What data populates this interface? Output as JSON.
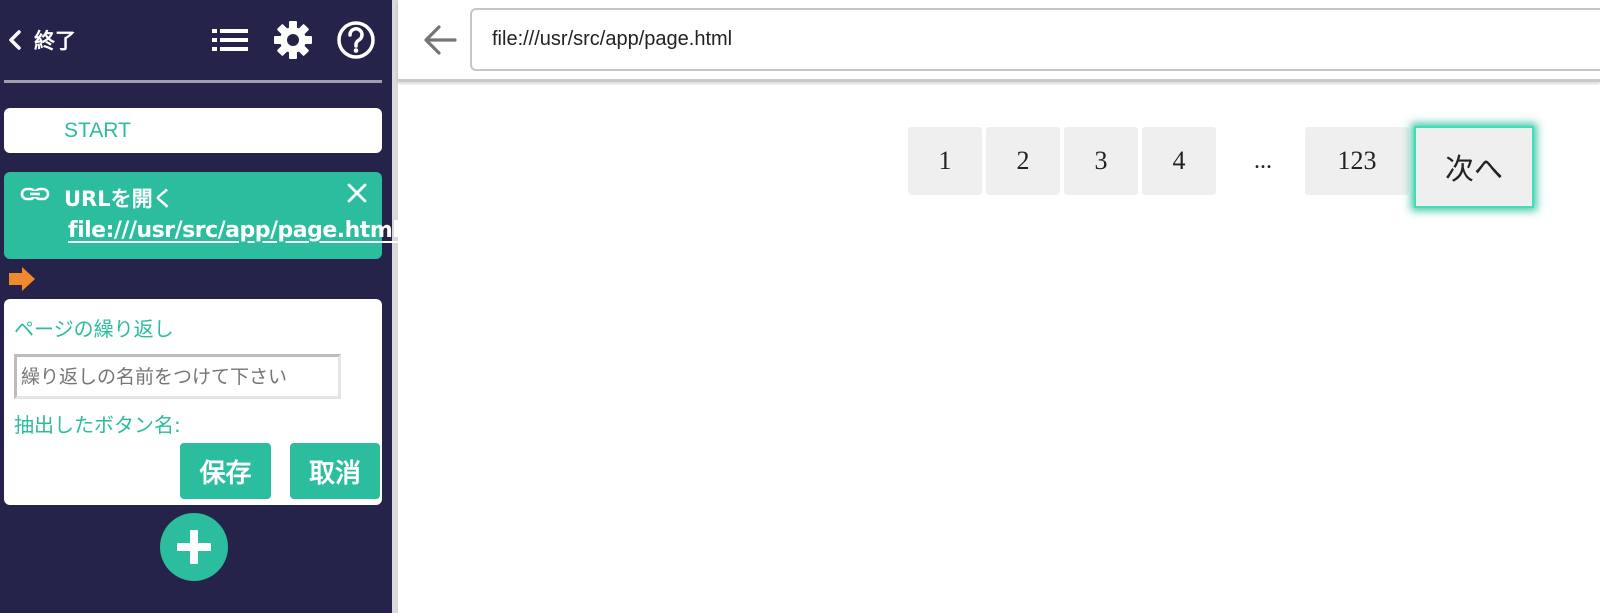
{
  "sidebar": {
    "exit_label": "終了",
    "icons": {
      "list": "list-icon",
      "settings": "gear-icon",
      "help": "help-icon"
    },
    "start_label": "START",
    "url_step": {
      "title": "URLを開く",
      "url": "file:///usr/src/app/page.html",
      "icon": "link-icon",
      "close_icon": "close-icon"
    },
    "loop_step": {
      "title": "ページの繰り返し",
      "name_placeholder": "繰り返しの名前をつけて下さい",
      "extracted_label": "抽出したボタン名:",
      "save_label": "保存",
      "cancel_label": "取消"
    },
    "add_icon": "plus-icon"
  },
  "browser": {
    "back_icon": "arrow-left-icon",
    "address": "file:///usr/src/app/page.html"
  },
  "pagination": {
    "pages": [
      "1",
      "2",
      "3",
      "4"
    ],
    "ellipsis": "...",
    "last_page": "123",
    "next_label": "次へ"
  },
  "colors": {
    "sidebar_bg": "#25234a",
    "accent": "#2bbd9d",
    "marker": "#f0892b",
    "highlight": "#3ddfb6"
  }
}
